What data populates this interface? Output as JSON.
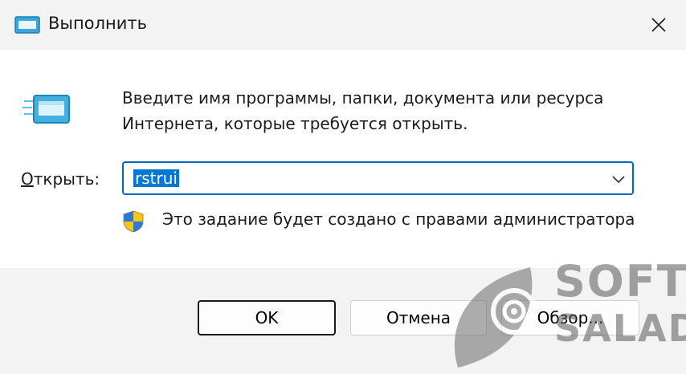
{
  "window": {
    "title": "Выполнить"
  },
  "content": {
    "description_line1": "Введите имя программы, папки, документа или ресурса",
    "description_line2": "Интернета, которые требуется открыть.",
    "open_label_accesskey": "О",
    "open_label_rest": "ткрыть:",
    "combo_value": "rstrui",
    "admin_note": "Это задание будет создано с правами администратора"
  },
  "buttons": {
    "ok": "OK",
    "cancel": "Отмена",
    "browse": "Обзор..."
  },
  "watermark": {
    "line1": "SOFT",
    "line2": "SALAD"
  },
  "icons": {
    "title": "run-icon",
    "main": "run-icon",
    "shield": "uac-shield-icon",
    "close": "close-icon",
    "dropdown": "chevron-down-icon"
  },
  "colors": {
    "accent": "#0067c0",
    "selection": "#0078d4"
  }
}
